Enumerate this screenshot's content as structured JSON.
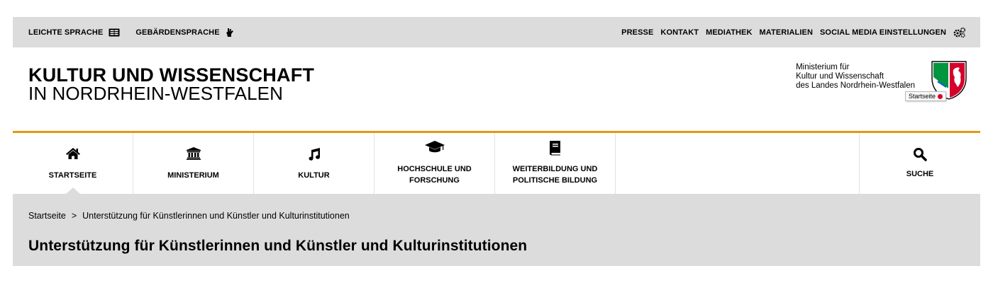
{
  "topbar": {
    "left": [
      {
        "label": "LEICHTE SPRACHE",
        "icon": "book-list-icon"
      },
      {
        "label": "GEBÄRDENSPRACHE",
        "icon": "sign-hand-icon"
      }
    ],
    "right": [
      "PRESSE",
      "KONTAKT",
      "MEDIATHEK",
      "MATERIALIEN",
      "SOCIAL MEDIA EINSTELLUNGEN"
    ],
    "settings_icon": "gears-icon"
  },
  "header": {
    "brand_line1": "KULTUR UND WISSENSCHAFT",
    "brand_line2": "IN NORDRHEIN-WESTFALEN",
    "ministry_line1": "Ministerium für",
    "ministry_line2": "Kultur und Wissenschaft",
    "ministry_line3": "des Landes Nordrhein-Westfalen",
    "crest_tooltip": "Startseite",
    "accent_color": "#e8960e"
  },
  "nav": {
    "items": [
      {
        "label1": "STARTSEITE",
        "label2": "",
        "icon": "home-icon",
        "active": true
      },
      {
        "label1": "MINISTERIUM",
        "label2": "",
        "icon": "institution-icon"
      },
      {
        "label1": "KULTUR",
        "label2": "",
        "icon": "music-note-icon"
      },
      {
        "label1": "HOCHSCHULE UND",
        "label2": "FORSCHUNG",
        "icon": "graduation-cap-icon"
      },
      {
        "label1": "WEITERBILDUNG UND",
        "label2": "POLITISCHE BILDUNG",
        "icon": "book-icon"
      }
    ],
    "search_label": "SUCHE"
  },
  "breadcrumb": {
    "home": "Startseite",
    "separator": ">",
    "current": "Unterstützung für Künstlerinnen und Künstler und Kulturinstitutionen"
  },
  "page": {
    "title": "Unterstützung für Künstlerinnen und Künstler und Kulturinstitutionen"
  }
}
